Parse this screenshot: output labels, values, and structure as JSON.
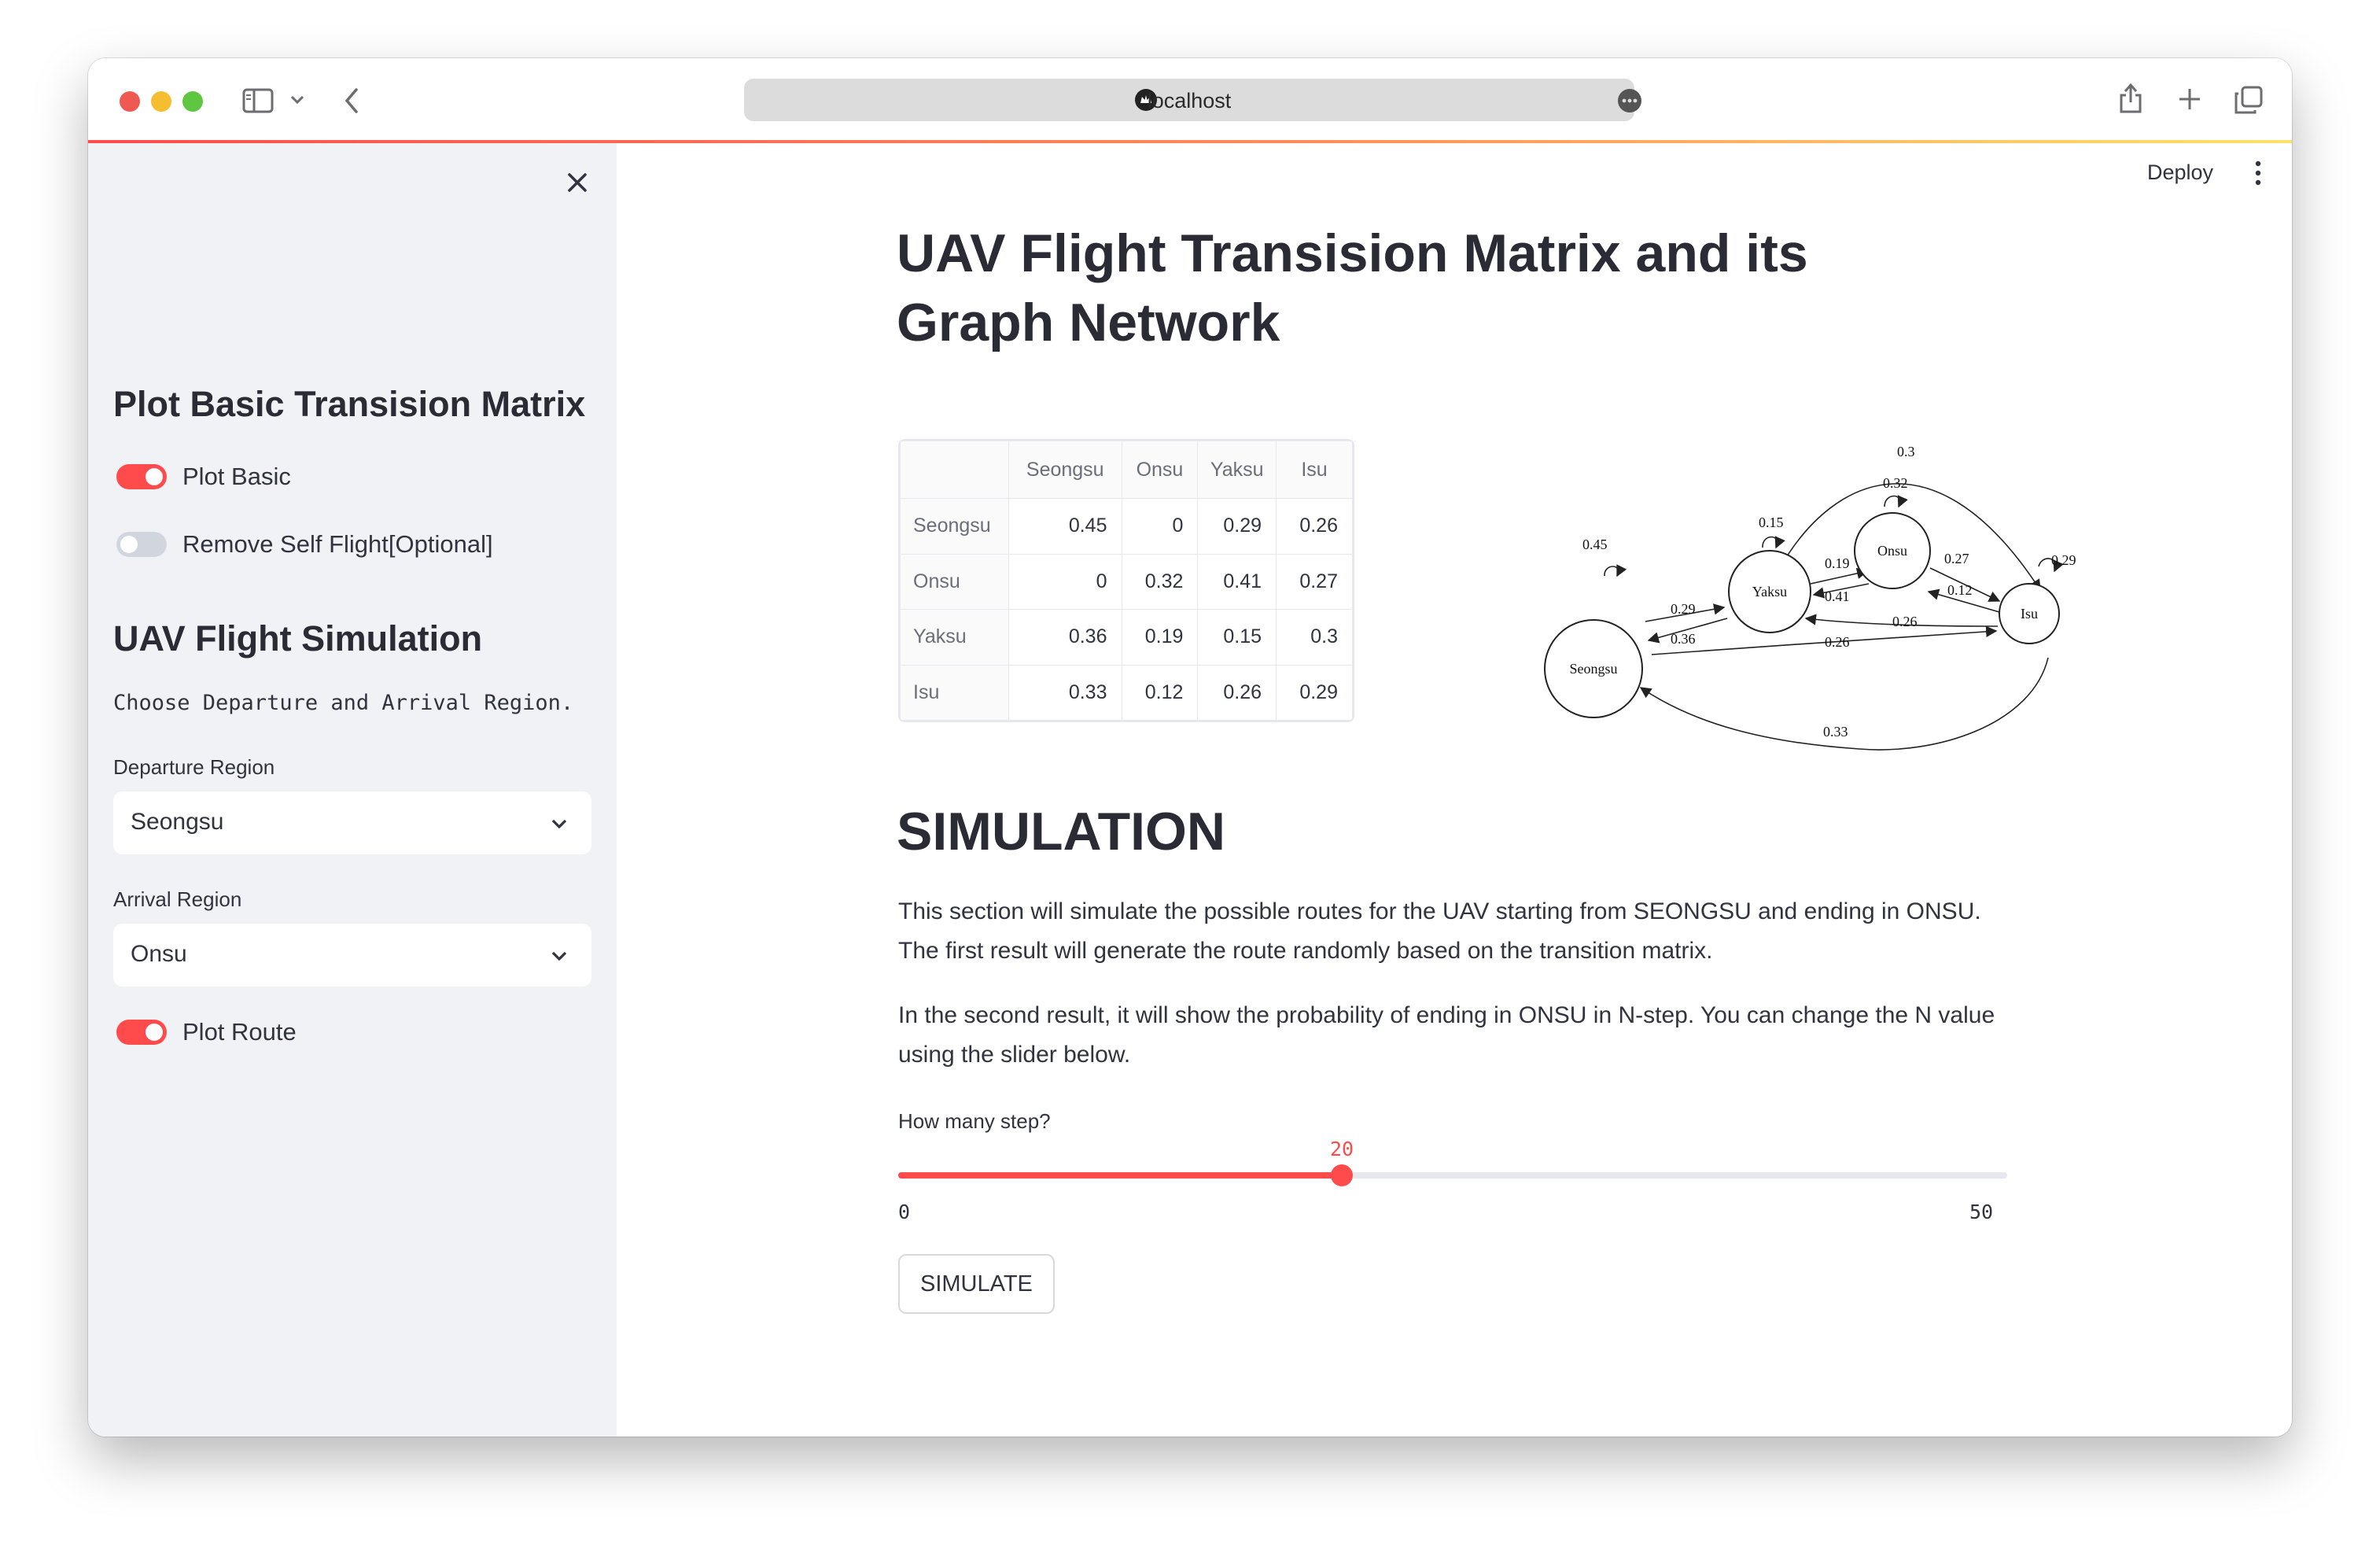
{
  "browser": {
    "url": "localhost"
  },
  "header": {
    "deploy_label": "Deploy"
  },
  "sidebar": {
    "section1_title": "Plot Basic Transision Matrix",
    "toggle_plot_basic": {
      "label": "Plot Basic",
      "checked": true
    },
    "toggle_remove_self": {
      "label": "Remove Self Flight[Optional]",
      "checked": false
    },
    "section2_title": "UAV Flight Simulation",
    "instruction": "Choose Departure and Arrival Region.",
    "departure": {
      "label": "Departure Region",
      "value": "Seongsu"
    },
    "arrival": {
      "label": "Arrival Region",
      "value": "Onsu"
    },
    "toggle_plot_route": {
      "label": "Plot Route",
      "checked": true
    }
  },
  "main": {
    "title": "UAV Flight Transision Matrix and its Graph Network",
    "matrix": {
      "columns": [
        "Seongsu",
        "Onsu",
        "Yaksu",
        "Isu"
      ],
      "rows": [
        {
          "label": "Seongsu",
          "values": [
            "0.45",
            "0",
            "0.29",
            "0.26"
          ]
        },
        {
          "label": "Onsu",
          "values": [
            "0",
            "0.32",
            "0.41",
            "0.27"
          ]
        },
        {
          "label": "Yaksu",
          "values": [
            "0.36",
            "0.19",
            "0.15",
            "0.3"
          ]
        },
        {
          "label": "Isu",
          "values": [
            "0.33",
            "0.12",
            "0.26",
            "0.29"
          ]
        }
      ]
    },
    "graph": {
      "nodes": {
        "seongsu": "Seongsu",
        "yaksu": "Yaksu",
        "onsu": "Onsu",
        "isu": "Isu"
      },
      "edge_labels": {
        "seongsu_self": "0.45",
        "yaksu_self": "0.15",
        "onsu_self": "0.32",
        "isu_self": "0.29",
        "seongsu_yaksu": "0.29",
        "yaksu_seongsu": "0.36",
        "yaksu_onsu": "0.19",
        "onsu_yaksu": "0.41",
        "onsu_isu": "0.27",
        "isu_onsu": "0.12",
        "isu_yaksu": "0.26",
        "seongsu_isu": "0.26",
        "yaksu_isu": "0.3",
        "isu_seongsu": "0.33"
      }
    },
    "simulation": {
      "title": "SIMULATION",
      "para1": "This section will simulate the possible routes for the UAV starting from SEONGSU and ending in ONSU. The first result will generate the route randomly based on the transition matrix.",
      "para2": "In the second result, it will show the probability of ending in ONSU in N-step. You can change the N value using the slider below.",
      "slider": {
        "label": "How many step?",
        "value": "20",
        "min": "0",
        "max": "50",
        "fraction": 0.4
      },
      "button_label": "SIMULATE"
    }
  },
  "colors": {
    "accent": "#ff4b4b",
    "sidebar_bg": "#f0f2f6",
    "text": "#31333f"
  }
}
